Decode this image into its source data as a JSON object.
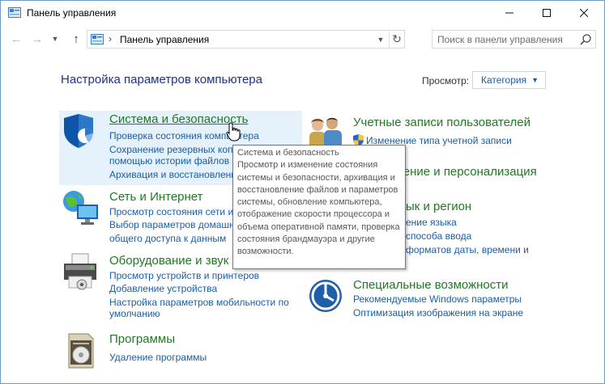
{
  "window": {
    "title": "Панель управления"
  },
  "nav": {
    "address_crumb": "Панель управления"
  },
  "search": {
    "placeholder": "Поиск в панели управления"
  },
  "content": {
    "heading": "Настройка параметров компьютера",
    "view_by_label": "Просмотр:",
    "view_by_value": "Категория"
  },
  "categories": {
    "system": {
      "title": "Система и безопасность",
      "links": [
        "Проверка состояния компьютера",
        "Сохранение резервных копий файлов с",
        "помощью истории файлов",
        "Архивация и восстановление (Windows 7)"
      ]
    },
    "network": {
      "title": "Сеть и Интернет",
      "links": [
        "Просмотр состояния сети и задач",
        "Выбор параметров домашней группы и",
        "общего доступа к данным"
      ]
    },
    "hardware": {
      "title": "Оборудование и звук",
      "links": [
        "Просмотр устройств и принтеров",
        "Добавление устройства",
        "Настройка параметров мобильности по",
        "умолчанию"
      ]
    },
    "programs": {
      "title": "Программы",
      "links": [
        "Удаление программы"
      ]
    },
    "users": {
      "title": "Учетные записи пользователей",
      "links": [
        "Изменение типа учетной записи"
      ]
    },
    "appearance": {
      "title": "ление и персонализация"
    },
    "region": {
      "title": "ык и регион",
      "links": [
        "ение языка",
        "способа ввода",
        "форматов даты, времени и"
      ]
    },
    "access": {
      "title": "Специальные возможности",
      "links": [
        "Рекомендуемые Windows параметры",
        "Оптимизация изображения на экране"
      ]
    }
  },
  "tooltip": {
    "title": "Система и безопасность",
    "body": "Просмотр и изменение состояния системы и безопасности, архивация и восстановление файлов и параметров системы, обновление компьютера, отображение скорости процессора и объема оперативной памяти, проверка состояния брандмауэра и другие возможности."
  },
  "icons": {
    "app": "control-panel-icon",
    "system": "shield-icon",
    "network": "network-globe-icon",
    "hardware": "printer-icon",
    "programs": "programs-box-icon",
    "users": "users-icon",
    "access": "ease-of-access-icon"
  },
  "colors": {
    "link": "#1a5ea6",
    "category_title": "#207a22",
    "heading": "#1e3287",
    "highlight": "#e5f1fb"
  }
}
